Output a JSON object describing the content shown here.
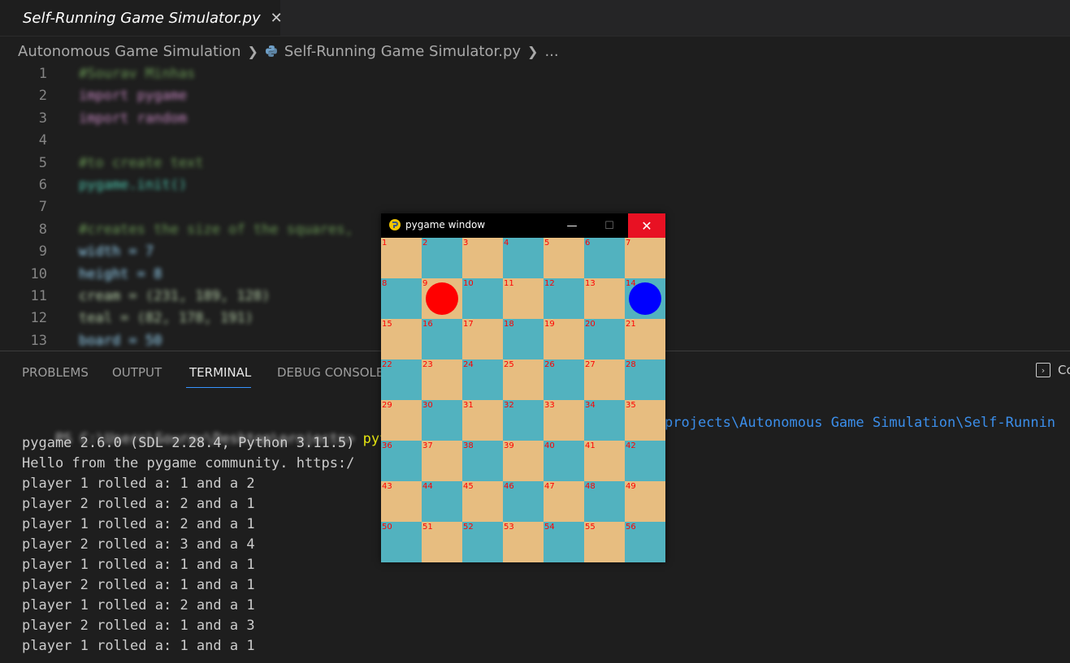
{
  "editor_tab": {
    "label": "Self-Running Game Simulator.py",
    "close": "✕"
  },
  "breadcrumb": {
    "folder": "Autonomous Game Simulation",
    "file": "Self-Running Game Simulator.py",
    "more": "..."
  },
  "code_lines": [
    {
      "n": "1",
      "text": "#Sourav Minhas"
    },
    {
      "n": "2",
      "text": "import pygame"
    },
    {
      "n": "3",
      "text": "import random"
    },
    {
      "n": "4",
      "text": ""
    },
    {
      "n": "5",
      "text": "#to create text"
    },
    {
      "n": "6",
      "text": "pygame.init()"
    },
    {
      "n": "7",
      "text": ""
    },
    {
      "n": "8",
      "text": "#creates the size of the squares,"
    },
    {
      "n": "9",
      "text": "width = 7"
    },
    {
      "n": "10",
      "text": "height = 8"
    },
    {
      "n": "11",
      "text": "cream = (231, 189, 128)"
    },
    {
      "n": "12",
      "text": "teal = (82, 178, 191)"
    },
    {
      "n": "13",
      "text": "board = 50"
    }
  ],
  "panel": {
    "tabs": [
      "PROBLEMS",
      "OUTPUT",
      "TERMINAL",
      "DEBUG CONSOLE"
    ],
    "active_tab": "TERMINAL",
    "right_button": "Co"
  },
  "terminal": {
    "prompt": "PS C:\\Users\\Sourav\\Desktop\\projects>",
    "command": "pyt",
    "command_path": "projects\\Autonomous Game Simulation\\Self-Runnin",
    "lines": [
      "pygame 2.6.0 (SDL 2.28.4, Python 3.11.5)",
      "Hello from the pygame community. https:/",
      "player 1 rolled a: 1 and a 2",
      "player 2 rolled a: 2 and a 1",
      "player 1 rolled a: 2 and a 1",
      "player 2 rolled a: 3 and a 4",
      "player 1 rolled a: 1 and a 1",
      "player 2 rolled a: 1 and a 1",
      "player 1 rolled a: 2 and a 1",
      "player 2 rolled a: 1 and a 3",
      "player 1 rolled a: 1 and a 1"
    ]
  },
  "pygame_window": {
    "title": "pygame window",
    "minimize": "—",
    "maximize": "☐",
    "close": "✕",
    "board": {
      "columns": 7,
      "rows": 8,
      "cream_color": "#e7bd80",
      "teal_color": "#52b2bf",
      "number_color": "#ff0000",
      "squares": [
        "1",
        "2",
        "3",
        "4",
        "5",
        "6",
        "7",
        "8",
        "9",
        "10",
        "11",
        "12",
        "13",
        "14",
        "15",
        "16",
        "17",
        "18",
        "19",
        "20",
        "21",
        "22",
        "23",
        "24",
        "25",
        "26",
        "27",
        "28",
        "29",
        "30",
        "31",
        "32",
        "33",
        "34",
        "35",
        "36",
        "37",
        "38",
        "39",
        "40",
        "41",
        "42",
        "43",
        "44",
        "45",
        "46",
        "47",
        "48",
        "49",
        "50",
        "51",
        "52",
        "53",
        "54",
        "55",
        "56"
      ],
      "tokens": [
        {
          "player": "1",
          "color": "#ff0000",
          "square": 9
        },
        {
          "player": "2",
          "color": "#0000ff",
          "square": 14
        }
      ]
    }
  }
}
